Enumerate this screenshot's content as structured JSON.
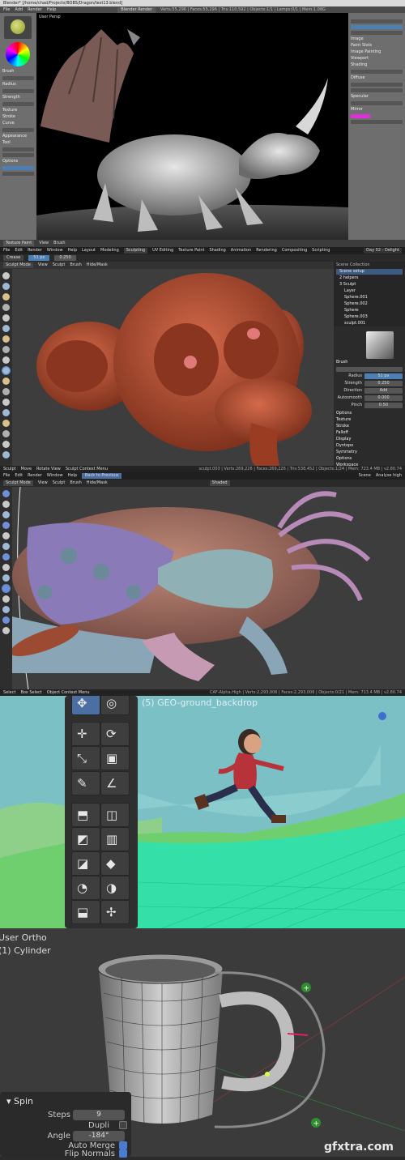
{
  "panel1": {
    "title": "Blender* [/home/chad/Projects/BOBS/Dragon/test13.blend]",
    "menu": [
      "File",
      "Add",
      "Render",
      "Help"
    ],
    "engine": "Blender Render",
    "stats": "Verts:55,296 | Faces:55,296 | Tris:110,592 | Objects:1/1 | Lamps:0/1 | Mem:1.08G",
    "view_label": "User Persp",
    "left_labels": [
      "Brush",
      "Radius",
      "Strength",
      "Texture",
      "Stroke",
      "Curve",
      "Appearance",
      "Tool",
      "Options"
    ],
    "bottom_labels": [
      "Texture Paint",
      "View",
      "Brush"
    ],
    "right_labels": [
      "Image",
      "Paint Slots",
      "Image Painting",
      "Viewport",
      "Shading",
      "Diffuse",
      "Specular",
      "Mirror"
    ]
  },
  "panel2": {
    "menu": [
      "File",
      "Edit",
      "Render",
      "Window",
      "Help"
    ],
    "tabs": [
      "Layout",
      "Modeling",
      "Sculpting",
      "UV Editing",
      "Texture Paint",
      "Shading",
      "Animation",
      "Rendering",
      "Compositing",
      "Scripting"
    ],
    "active_tab": "Sculpting",
    "scene": "Day 02 - Delight",
    "mode": "Sculpt Mode",
    "header_menus": [
      "View",
      "Sculpt",
      "Brush",
      "Hide/Mask"
    ],
    "brush_name": "Crease",
    "outliner_title": "Scene Collection",
    "outliner": [
      "Scene setup",
      "2 helpers",
      "3 Sculpt",
      "Layer",
      "Sphere.001",
      "Sphere.002",
      "Sphere",
      "Sphere.003",
      "sculpt.001"
    ],
    "brush_panel": "Brush",
    "props": [
      {
        "k": "Radius",
        "v": "51 px"
      },
      {
        "k": "Strength",
        "v": "0.250"
      },
      {
        "k": "Direction",
        "v": "Add"
      },
      {
        "k": "Autosmooth",
        "v": "0.000"
      },
      {
        "k": "Pinch",
        "v": "0.50"
      }
    ],
    "sections": [
      "Options",
      "Texture",
      "Stroke",
      "Falloff",
      "Display",
      "Dyntopo",
      "Symmetry",
      "Options",
      "Workspace"
    ],
    "status": [
      "Sculpt",
      "Move",
      "Rotate View",
      "Sculpt Context Menu"
    ],
    "status_right": "sculpt.003 | Verts:269,226 | Faces:269,226 | Tris:538,452 | Objects:1/24 | Mem: 723.4 MB | v2.80.74"
  },
  "panel3": {
    "menu": [
      "File",
      "Edit",
      "Render",
      "Window",
      "Help"
    ],
    "back_button": "Back to Previous",
    "mode": "Sculpt Mode",
    "header_menus": [
      "View",
      "Sculpt",
      "Brush",
      "Hide/Mask"
    ],
    "shading": "Shaded",
    "scene": "Scene",
    "layer": "Analyse high",
    "status": [
      "Select",
      "Box Select",
      "Object Context Menu"
    ],
    "status_right": "CAF-Alpha.High | Verts:2,293,006 | Faces:2,293,006 | Objects:0/21 | Mem: 713.4 MB | v2.80.74"
  },
  "panel4": {
    "viewport_label": "(5) GEO-ground_backdrop"
  },
  "panel5": {
    "view_label": "User Ortho",
    "object_label": "(1) Cylinder",
    "operator": "Spin",
    "steps_label": "Steps",
    "steps": "9",
    "dupli_label": "Dupli",
    "angle_label": "Angle",
    "angle": "-184°",
    "auto_merge_label": "Auto Merge",
    "flip_normals_label": "Flip Normals"
  },
  "watermark": "gfxtra.com"
}
